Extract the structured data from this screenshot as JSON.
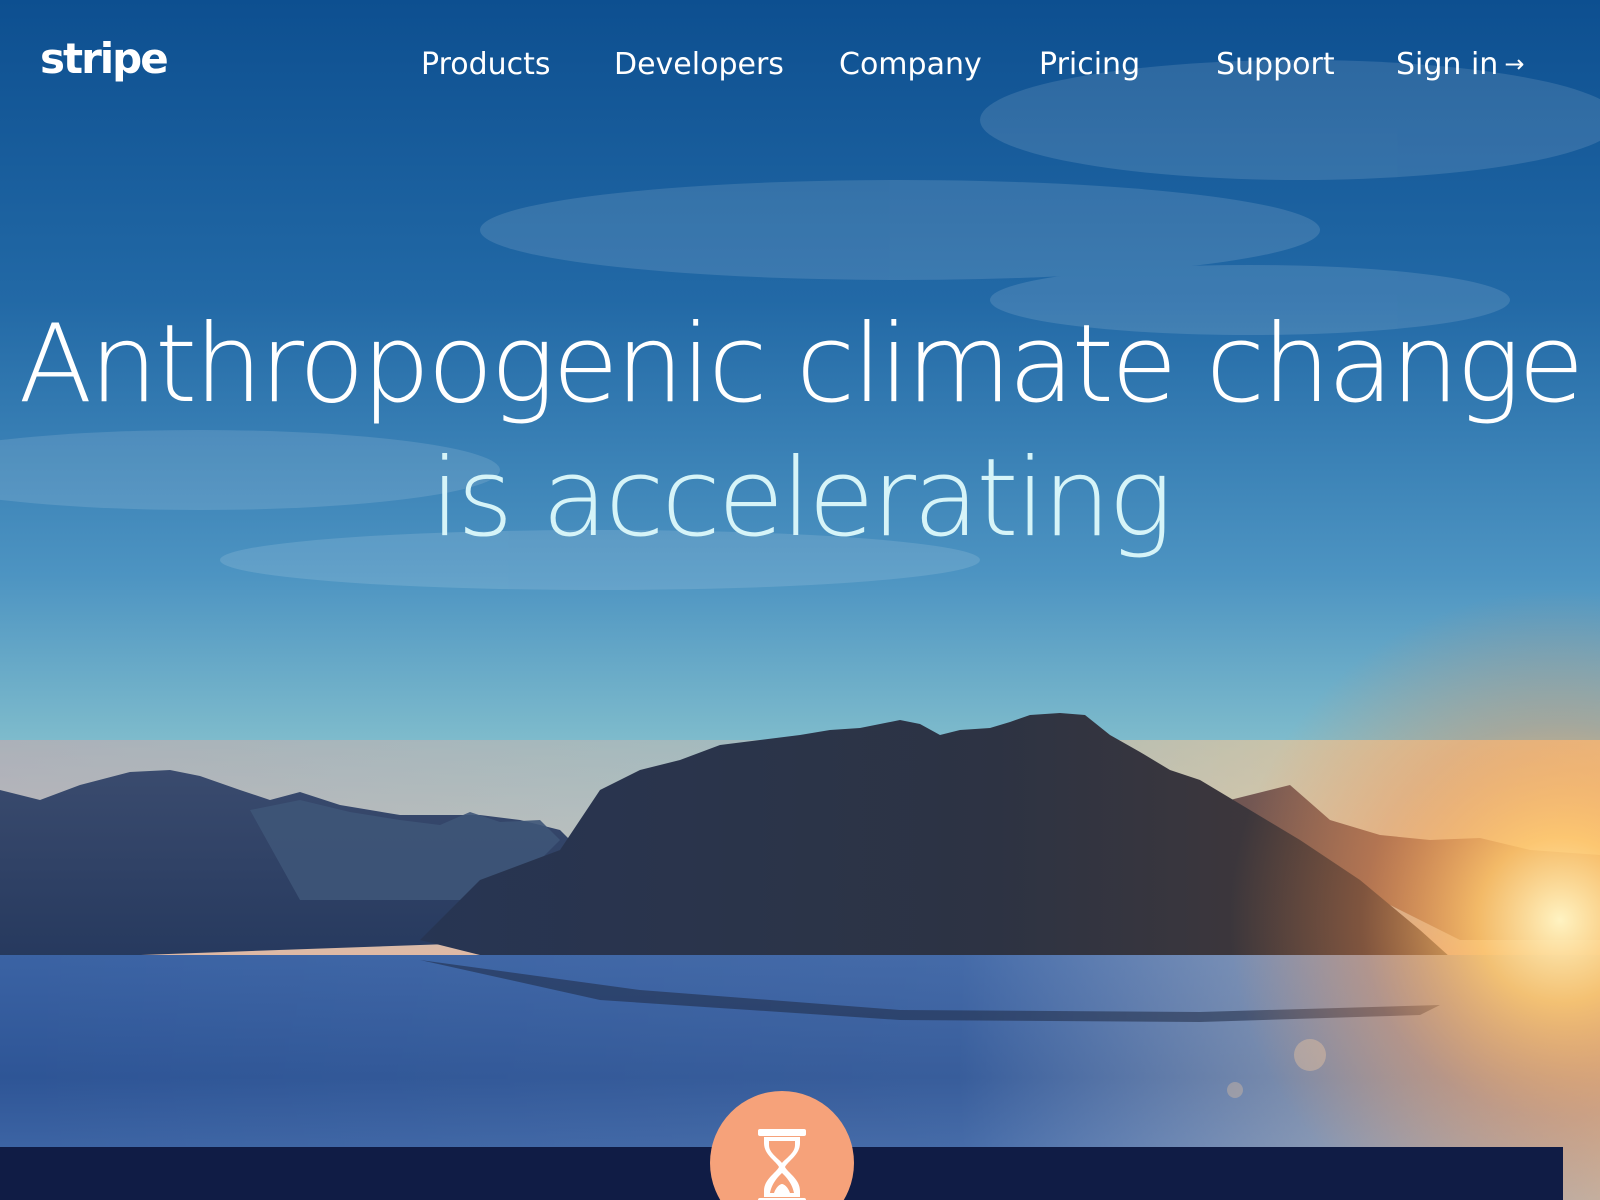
{
  "header": {
    "logo_text": "stripe",
    "nav": {
      "products": "Products",
      "developers": "Developers",
      "company": "Company",
      "pricing": "Pricing",
      "support": "Support",
      "signin": "Sign in",
      "signin_icon": "arrow-right-icon"
    }
  },
  "hero": {
    "headline_line1": "Anthropogenic climate change",
    "headline_line2": "is accelerating",
    "badge_icon": "hourglass-icon"
  },
  "colors": {
    "sky_top": "#0d4f90",
    "sky_bottom": "#7fc0cf",
    "headline_accent": "#d6f4f8",
    "bottom_bar": "#101c45",
    "badge": "#f6a27a"
  }
}
